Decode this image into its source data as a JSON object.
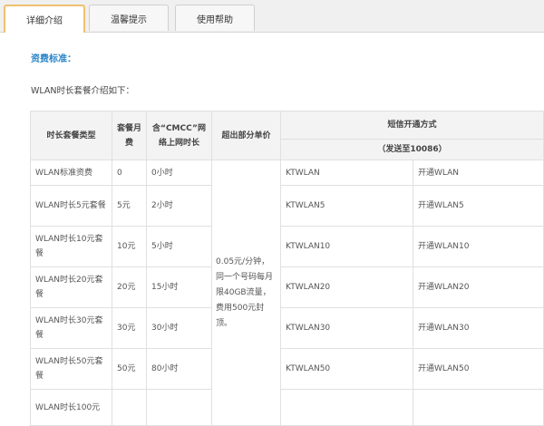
{
  "tabs": [
    {
      "label": "详细介绍",
      "active": true
    },
    {
      "label": "温馨提示",
      "active": false
    },
    {
      "label": "使用帮助",
      "active": false
    }
  ],
  "section_title": "资费标准：",
  "intro": "WLAN时长套餐介绍如下：",
  "table": {
    "headers": {
      "type": "时长套餐类型",
      "fee": "套餐月费",
      "duration": "含“CMCC”网络上网时长",
      "excess": "超出部分单价",
      "sms": "短信开通方式",
      "send_to": "（发送至10086）"
    },
    "excess_note": "0.05元/分钟，同一个号码每月限40GB流量，费用500元封顶。",
    "rows": [
      {
        "type": "WLAN标准资费",
        "fee": "0",
        "duration": "0小时",
        "code": "KTWLAN",
        "action": "开通WLAN"
      },
      {
        "type": "WLAN时长5元套餐",
        "fee": "5元",
        "duration": "2小时",
        "code": "KTWLAN5",
        "action": "开通WLAN5"
      },
      {
        "type": "WLAN时长10元套餐",
        "fee": "10元",
        "duration": "5小时",
        "code": "KTWLAN10",
        "action": "开通WLAN10"
      },
      {
        "type": "WLAN时长20元套餐",
        "fee": "20元",
        "duration": "15小时",
        "code": "KTWLAN20",
        "action": "开通WLAN20"
      },
      {
        "type": "WLAN时长30元套餐",
        "fee": "30元",
        "duration": "30小时",
        "code": "KTWLAN30",
        "action": "开通WLAN30"
      },
      {
        "type": "WLAN时长50元套餐",
        "fee": "50元",
        "duration": "80小时",
        "code": "KTWLAN50",
        "action": "开通WLAN50"
      },
      {
        "type": "WLAN时长100元",
        "fee": "",
        "duration": "",
        "code": "",
        "action": ""
      }
    ]
  }
}
